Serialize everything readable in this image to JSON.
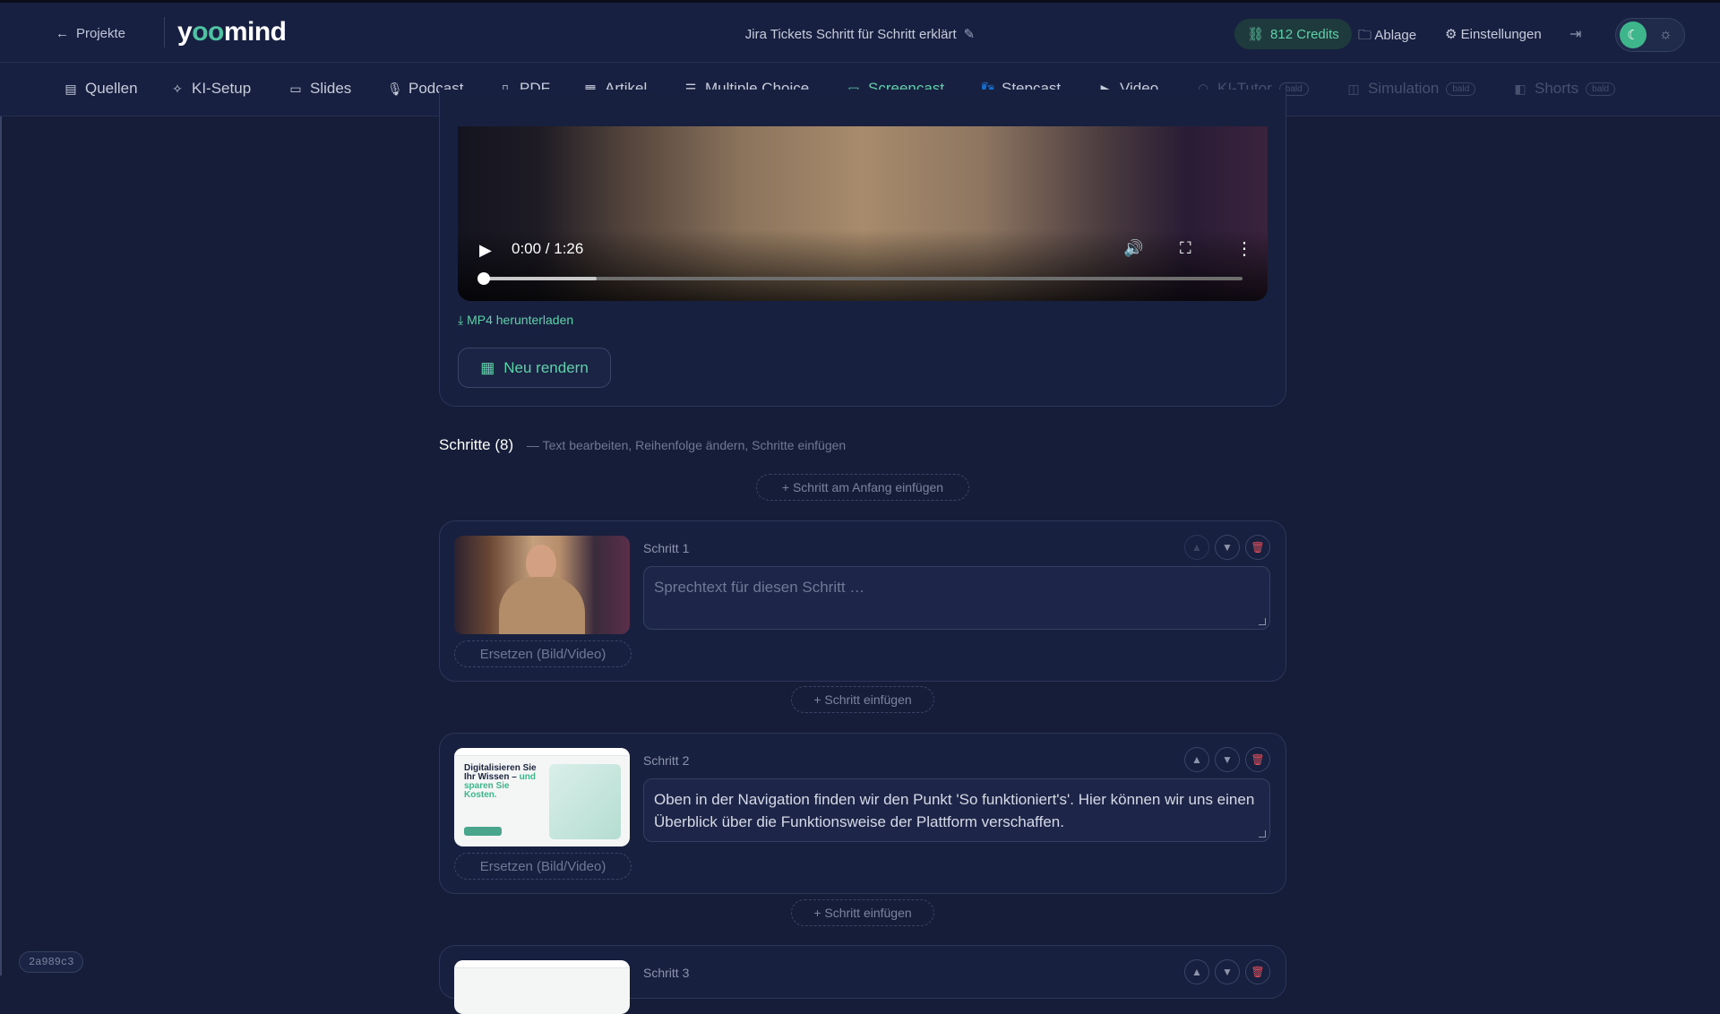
{
  "header": {
    "back_label": "Projekte",
    "logo_text_a": "y",
    "logo_text_oo": "oo",
    "logo_text_b": "mind",
    "title": "Jira Tickets Schritt für Schritt erklärt",
    "credits": "812 Credits",
    "ablage": "Ablage",
    "einstellungen": "Einstellungen"
  },
  "tabs": [
    {
      "label": "Quellen",
      "icon": "document-icon"
    },
    {
      "label": "KI-Setup",
      "icon": "sparkles-icon"
    },
    {
      "label": "Slides",
      "icon": "presentation-icon"
    },
    {
      "label": "Podcast",
      "icon": "microphone-icon"
    },
    {
      "label": "PDF",
      "icon": "book-icon"
    },
    {
      "label": "Artikel",
      "icon": "article-icon"
    },
    {
      "label": "Multiple Choice",
      "icon": "checklist-icon"
    },
    {
      "label": "Screencast",
      "icon": "monitor-icon",
      "active": true
    },
    {
      "label": "Stepcast",
      "icon": "footsteps-icon"
    },
    {
      "label": "Video",
      "icon": "video-icon"
    },
    {
      "label": "KI-Tutor",
      "icon": "robot-icon",
      "disabled": true,
      "badge": "bald"
    },
    {
      "label": "Simulation",
      "icon": "gamepad-icon",
      "disabled": true,
      "badge": "bald"
    },
    {
      "label": "Shorts",
      "icon": "clapperboard-icon",
      "disabled": true,
      "badge": "bald"
    }
  ],
  "video": {
    "time": "0:00 / 1:26",
    "progress": 0.0,
    "buffered": 0.15
  },
  "download_label": "MP4 herunterladen",
  "rerender_label": "Neu rendern",
  "steps": {
    "title": "Schritte (8)",
    "subtitle": "— Text bearbeiten, Reihenfolge ändern, Schritte einfügen",
    "insert_start": "+ Schritt am Anfang einfügen",
    "insert": "+ Schritt einfügen",
    "replace_label": "Ersetzen (Bild/Video)",
    "placeholder": "Sprechtext für diesen Schritt …",
    "items": [
      {
        "label": "Schritt 1",
        "text": ""
      },
      {
        "label": "Schritt 2",
        "text": "Oben in der Navigation finden wir den Punkt 'So funktioniert's'. Hier können wir uns einen Überblick über die Funktionsweise der Plattform verschaffen.",
        "thumb_heading_a": "Digitalisieren Sie Ihr Wissen – ",
        "thumb_heading_b": "und sparen Sie Kosten."
      },
      {
        "label": "Schritt 3"
      }
    ]
  },
  "build_hash": "2a989c3",
  "colors": {
    "accent": "#5fd1a9",
    "background": "#161d38",
    "danger": "#e2525e"
  }
}
